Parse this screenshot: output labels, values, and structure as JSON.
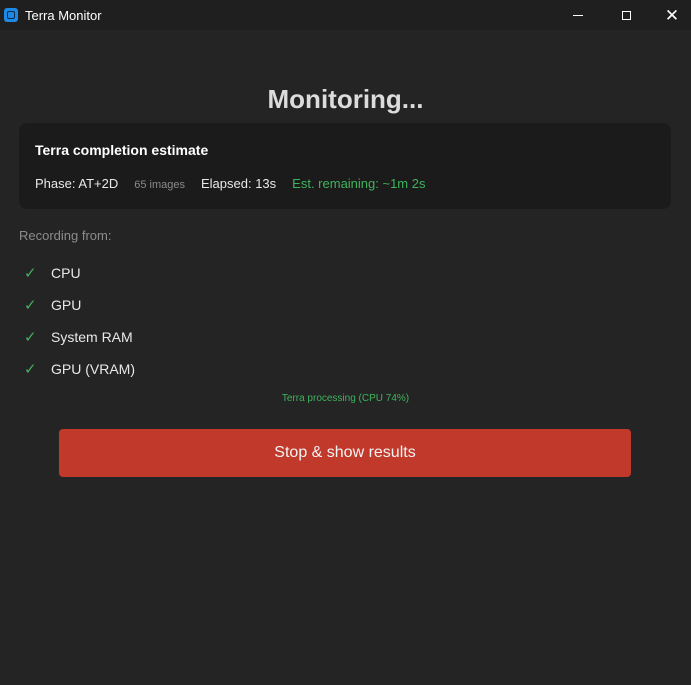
{
  "window": {
    "title": "Terra Monitor",
    "minimize_icon": "minimize-icon",
    "maximize_icon": "maximize-icon",
    "close_icon": "close-icon"
  },
  "heading": "Monitoring...",
  "estimate": {
    "title": "Terra completion estimate",
    "phase": "Phase: AT+2D",
    "images": "65 images",
    "elapsed": "Elapsed: 13s",
    "remaining": "Est. remaining: ~1m 2s"
  },
  "recording": {
    "label": "Recording from:",
    "sources": [
      {
        "check": "✓",
        "label": "CPU"
      },
      {
        "check": "✓",
        "label": "GPU"
      },
      {
        "check": "✓",
        "label": "System RAM"
      },
      {
        "check": "✓",
        "label": "GPU (VRAM)"
      }
    ]
  },
  "status_text": "Terra processing (CPU 74%)",
  "stop_button_label": "Stop & show results",
  "colors": {
    "accent_green": "#3fb35c",
    "stop_red": "#c0392b",
    "background": "#242424",
    "card": "#1b1b1b"
  }
}
